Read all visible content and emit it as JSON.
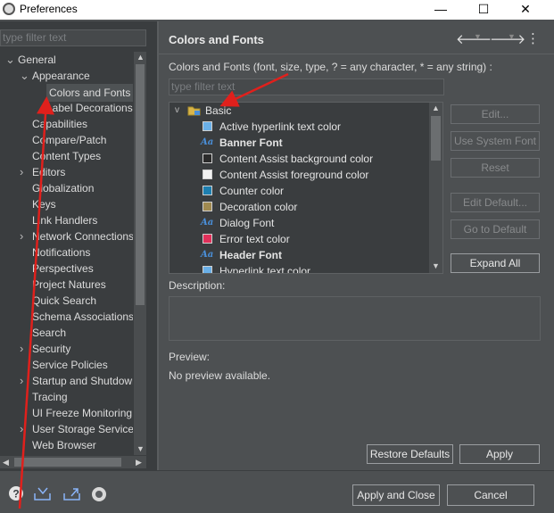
{
  "window": {
    "title": "Preferences",
    "minimize": "—",
    "maximize": "☐",
    "close": "✕"
  },
  "left": {
    "filter_placeholder": "type filter text",
    "tree": [
      {
        "label": "General",
        "indent": 0,
        "arrow": "v"
      },
      {
        "label": "Appearance",
        "indent": 1,
        "arrow": "v"
      },
      {
        "label": "Colors and Fonts",
        "indent": 2,
        "arrow": "",
        "selected": true
      },
      {
        "label": "Label Decorations",
        "indent": 2,
        "arrow": ""
      },
      {
        "label": "Capabilities",
        "indent": 1,
        "arrow": ""
      },
      {
        "label": "Compare/Patch",
        "indent": 1,
        "arrow": ""
      },
      {
        "label": "Content Types",
        "indent": 1,
        "arrow": ""
      },
      {
        "label": "Editors",
        "indent": 1,
        "arrow": ">"
      },
      {
        "label": "Globalization",
        "indent": 1,
        "arrow": ""
      },
      {
        "label": "Keys",
        "indent": 1,
        "arrow": ""
      },
      {
        "label": "Link Handlers",
        "indent": 1,
        "arrow": ""
      },
      {
        "label": "Network Connections",
        "indent": 1,
        "arrow": ">"
      },
      {
        "label": "Notifications",
        "indent": 1,
        "arrow": ""
      },
      {
        "label": "Perspectives",
        "indent": 1,
        "arrow": ""
      },
      {
        "label": "Project Natures",
        "indent": 1,
        "arrow": ""
      },
      {
        "label": "Quick Search",
        "indent": 1,
        "arrow": ""
      },
      {
        "label": "Schema Associations",
        "indent": 1,
        "arrow": ""
      },
      {
        "label": "Search",
        "indent": 1,
        "arrow": ""
      },
      {
        "label": "Security",
        "indent": 1,
        "arrow": ">"
      },
      {
        "label": "Service Policies",
        "indent": 1,
        "arrow": ""
      },
      {
        "label": "Startup and Shutdown",
        "indent": 1,
        "arrow": ">"
      },
      {
        "label": "Tracing",
        "indent": 1,
        "arrow": ""
      },
      {
        "label": "UI Freeze Monitoring",
        "indent": 1,
        "arrow": ""
      },
      {
        "label": "User Storage Service",
        "indent": 1,
        "arrow": ">"
      },
      {
        "label": "Web Browser",
        "indent": 1,
        "arrow": ""
      }
    ]
  },
  "right": {
    "title": "Colors and Fonts",
    "description": "Colors and Fonts (font, size, type, ? = any character, * = any string) :",
    "filter_placeholder": "type filter text",
    "tree_root": "Basic",
    "items": [
      {
        "label": "Active hyperlink text color",
        "kind": "color",
        "color": "#6ab0e8",
        "bold": false
      },
      {
        "label": "Banner Font",
        "kind": "font",
        "bold": true
      },
      {
        "label": "Content Assist background color",
        "kind": "color",
        "color": "#2b2b2b",
        "bold": false
      },
      {
        "label": "Content Assist foreground color",
        "kind": "color",
        "color": "#f2f2f2",
        "bold": false
      },
      {
        "label": "Counter color",
        "kind": "color",
        "color": "#1d7fb0",
        "bold": false
      },
      {
        "label": "Decoration color",
        "kind": "color",
        "color": "#a08a50",
        "bold": false
      },
      {
        "label": "Dialog Font",
        "kind": "font",
        "bold": false
      },
      {
        "label": "Error text color",
        "kind": "color",
        "color": "#e0305a",
        "bold": false
      },
      {
        "label": "Header Font",
        "kind": "font",
        "bold": true
      },
      {
        "label": "Hyperlink text color",
        "kind": "color",
        "color": "#6ab0e8",
        "bold": false
      }
    ],
    "buttons": {
      "edit": "Edit...",
      "use_system_font": "Use System Font",
      "reset": "Reset",
      "edit_default": "Edit Default...",
      "go_to_default": "Go to Default",
      "expand_all": "Expand All"
    },
    "description_label": "Description:",
    "preview_label": "Preview:",
    "preview_text": "No preview available.",
    "restore_defaults": "Restore Defaults",
    "apply": "Apply"
  },
  "bottom": {
    "apply_and_close": "Apply and Close",
    "cancel": "Cancel",
    "icons": [
      "help-icon",
      "import-icon",
      "export-icon",
      "record-icon"
    ]
  },
  "colors": {
    "annotation": "#e0201c",
    "accent": "#4a8fd9"
  }
}
